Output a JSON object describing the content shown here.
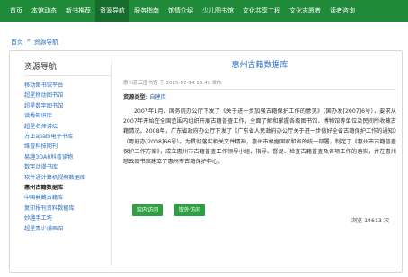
{
  "nav": {
    "items": [
      "首页",
      "本馆动态",
      "新书推荐",
      "资源导航",
      "服务指南",
      "馆情介绍",
      "少儿图书馆",
      "文化共享工程",
      "文化志愿者",
      "读者咨询"
    ],
    "active_index": 3,
    "colors": {
      "bar": "#1f8a3a",
      "active": "#166c2c"
    }
  },
  "breadcrumb": {
    "home": "首页",
    "sep": "»",
    "current": "资源导航"
  },
  "sidebar": {
    "title": "资源导航",
    "items": [
      "移动图书馆平台",
      "超星移动图书馆",
      "超星数字图书馆",
      "读秀知识库",
      "超星名师讲坛",
      "方正apabi电子书库",
      "维普科技期刊",
      "易趣3DAR科普读物",
      "数字动漫书库",
      "软件通计算机视频数据库",
      "惠州古籍数据库",
      "中国典藏古籍库",
      "复印报刊资料数据库",
      "妙趣手工坊",
      "超星青少漫画馆"
    ],
    "active_index": 10
  },
  "article": {
    "title": "惠州古籍数据库",
    "meta": "惠州慈云图书馆 于 2015-07-14 16:45 发布",
    "resource_type_label": "资源类型:",
    "resource_type_value": "自建库",
    "body": "2007年1月，国务院办公厅下发了《关于进一步加强古籍保护工作的意见》（国办发[2007]6号），要求从2007年开始在全国范围内组织开展古籍普查工作，全面了解和掌握各级图书馆、博物馆等单位及民间所收藏古籍情况。2008年，广东省政府办公厅下发了《广东省人民政府办公厅关于进一步做好全省古籍保护工作的通知》（粤府办[2008]66号）。为贯彻落实相关文件精神，惠州市根据国家和省的统一部署，制定了《惠州市古籍普查保护工作方案》，成立惠州市古籍普查工作领导小组，指导、督促、检查古籍普查及各项工作的落实，并在惠州慈云图书馆建立了惠州市古籍保护中心。",
    "buttons": {
      "internal": "馆内访问",
      "external": "馆外访问"
    },
    "views_label": "浏览",
    "views_count": "14613",
    "views_unit": "次"
  }
}
